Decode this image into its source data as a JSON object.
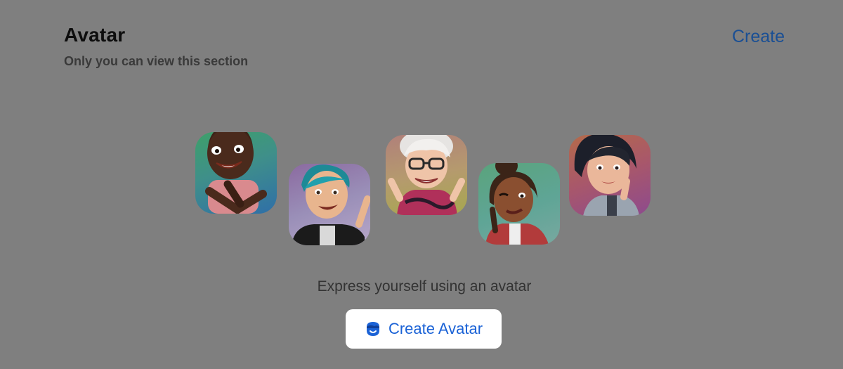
{
  "header": {
    "title": "Avatar",
    "subtitle": "Only you can view this section",
    "create_link": "Create"
  },
  "main": {
    "tagline": "Express yourself using an avatar",
    "create_avatar_button": "Create Avatar"
  },
  "colors": {
    "background": "#7f7f7f",
    "link": "#1a4f94",
    "button_text": "#1a62d6",
    "button_bg": "#ffffff"
  },
  "icons": {
    "button_icon": "avatar-face-icon"
  }
}
